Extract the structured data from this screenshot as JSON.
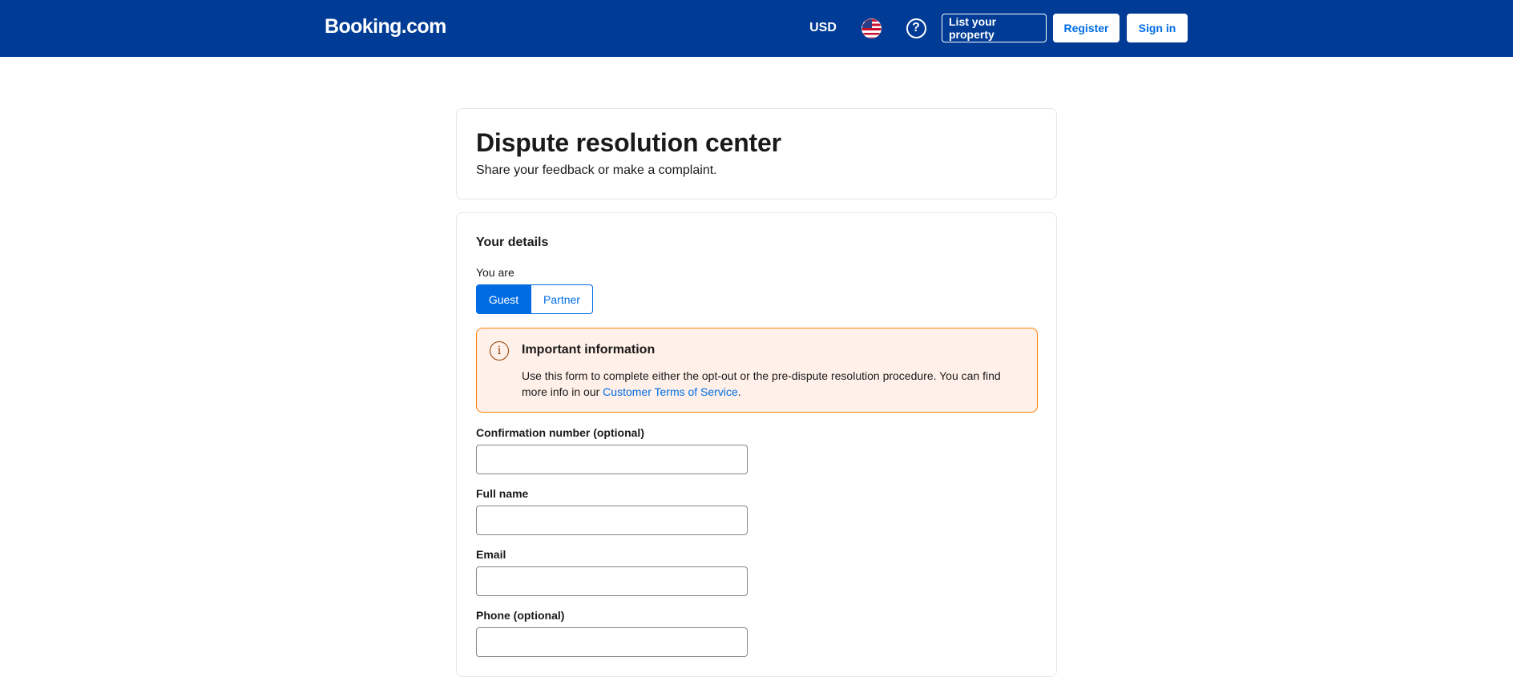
{
  "header": {
    "logo": "Booking.com",
    "currency": "USD",
    "language_icon": "us-flag-icon",
    "help_icon": "question-circle-icon",
    "list_property_label": "List your property",
    "register_label": "Register",
    "sign_in_label": "Sign in",
    "background_color": "#003b95"
  },
  "page": {
    "title": "Dispute resolution center",
    "subtitle": "Share your feedback or make a complaint."
  },
  "form": {
    "section_title": "Your details",
    "role_label": "You are",
    "roles": [
      {
        "label": "Guest",
        "selected": true
      },
      {
        "label": "Partner",
        "selected": false
      }
    ],
    "notice": {
      "icon": "info-circle-icon",
      "title": "Important information",
      "body_line": "Use this form to complete either the opt-out or the pre-dispute resolution procedure. You can find more info in our",
      "link_text": "Customer Terms of Service",
      "suffix": ".",
      "border_color": "#ff8000",
      "background_color": "#fff0e9"
    },
    "fields": [
      {
        "label": "Confirmation number (optional)",
        "value": ""
      },
      {
        "label": "Full name",
        "value": ""
      },
      {
        "label": "Email",
        "value": ""
      },
      {
        "label": "Phone (optional)",
        "value": ""
      }
    ]
  },
  "colors": {
    "accent": "#006ce4",
    "text": "#1a1a1a"
  }
}
